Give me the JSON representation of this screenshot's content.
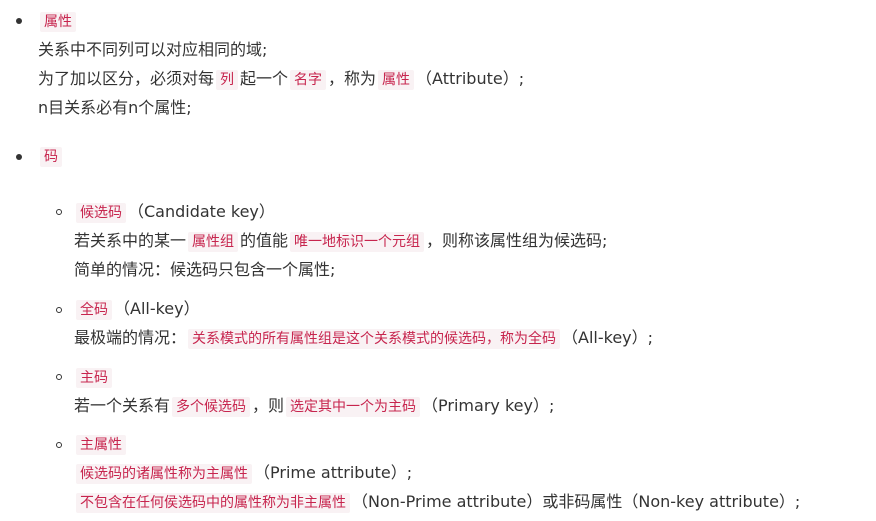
{
  "attribute_section": {
    "title": "属性",
    "line1": "关系中不同列可以对应相同的域;",
    "line2": {
      "t1": "为了加以区分，必须对每",
      "c1": "列",
      "t2": "起一个",
      "c2": "名字",
      "t3": "，称为",
      "c3": "属性",
      "t4": "（Attribute）;"
    },
    "line3": "n目关系必有n个属性;"
  },
  "key_section": {
    "title": "码",
    "candidate": {
      "title": "候选码",
      "title_suffix": "（Candidate key）",
      "line1": {
        "t1": "若关系中的某一",
        "c1": "属性组",
        "t2": "的值能",
        "c2": "唯一地标识一个元组",
        "t3": "，则称该属性组为候选码;"
      },
      "line2": "简单的情况：候选码只包含一个属性;"
    },
    "allkey": {
      "title": "全码",
      "title_suffix": "（All-key）",
      "line1": {
        "t1": "最极端的情况：",
        "c1": "关系模式的所有属性组是这个关系模式的候选码，称为全码",
        "t2": "（All-key）;"
      }
    },
    "primary": {
      "title": "主码",
      "line1": {
        "t1": "若一个关系有",
        "c1": "多个候选码",
        "t2": "，则",
        "c2": "选定其中一个为主码",
        "t3": "（Primary key）;"
      }
    },
    "prime": {
      "title": "主属性",
      "line1": {
        "c1": "候选码的诸属性称为主属性",
        "t1": "（Prime attribute）;"
      },
      "line2": {
        "c1": "不包含在任何侯选码中的属性称为非主属性",
        "t1": "（Non-Prime attribute）或非码属性（Non-key attribute）;"
      }
    }
  }
}
